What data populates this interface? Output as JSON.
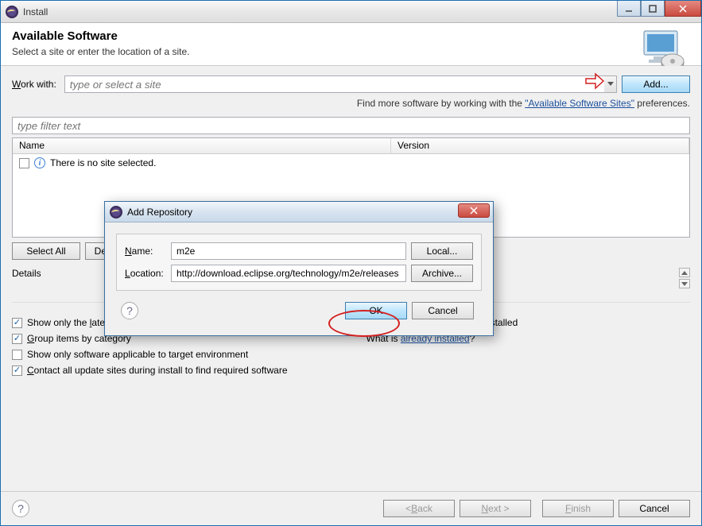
{
  "window": {
    "title": "Install"
  },
  "banner": {
    "heading": "Available Software",
    "subtitle": "Select a site or enter the location of a site."
  },
  "workwith": {
    "label_pre": "W",
    "label_post": "ork with:",
    "placeholder": "type or select a site",
    "add_button": "Add..."
  },
  "hint": {
    "text_pre": "Find more software by working with the ",
    "link": "\"Available Software Sites\"",
    "text_post": " preferences."
  },
  "filter": {
    "placeholder": "type filter text"
  },
  "tree": {
    "col_name": "Name",
    "col_version": "Version",
    "empty_msg": "There is no site selected."
  },
  "buttons": {
    "select_all_pre": "S",
    "select_all_post": "elect All",
    "deselect_all": "Deselect All"
  },
  "details": {
    "label": "Details"
  },
  "options": {
    "latest_pre": "Show only the ",
    "latest_u": "l",
    "latest_post": "atest versions of available software",
    "latest_checked": true,
    "group_pre": "G",
    "group_post": "roup items by category",
    "group_checked": true,
    "applicable": "Show only software applicable to target environment",
    "applicable_checked": false,
    "contact_pre": "C",
    "contact_post": "ontact all update sites during install to find required software",
    "contact_checked": true,
    "hide_pre": "H",
    "hide_post": "ide items that are already installed",
    "hide_checked": true,
    "whatis_pre": "What is ",
    "whatis_link": "already installed",
    "whatis_post": "?"
  },
  "footer": {
    "back_pre": "< ",
    "back_u": "B",
    "back_post": "ack",
    "next_pre": "N",
    "next_post": "ext >",
    "finish_pre": "F",
    "finish_post": "inish",
    "cancel": "Cancel"
  },
  "modal": {
    "title": "Add Repository",
    "name_label_pre": "N",
    "name_label_post": "ame:",
    "name_value": "m2e",
    "local_button_pre": "L",
    "local_button_post": "ocal...",
    "location_label_pre": "L",
    "location_label_post": "ocation:",
    "location_value": "http://download.eclipse.org/technology/m2e/releases",
    "archive_button_pre": "A",
    "archive_button_post": "rchive...",
    "ok": "OK",
    "cancel": "Cancel"
  }
}
